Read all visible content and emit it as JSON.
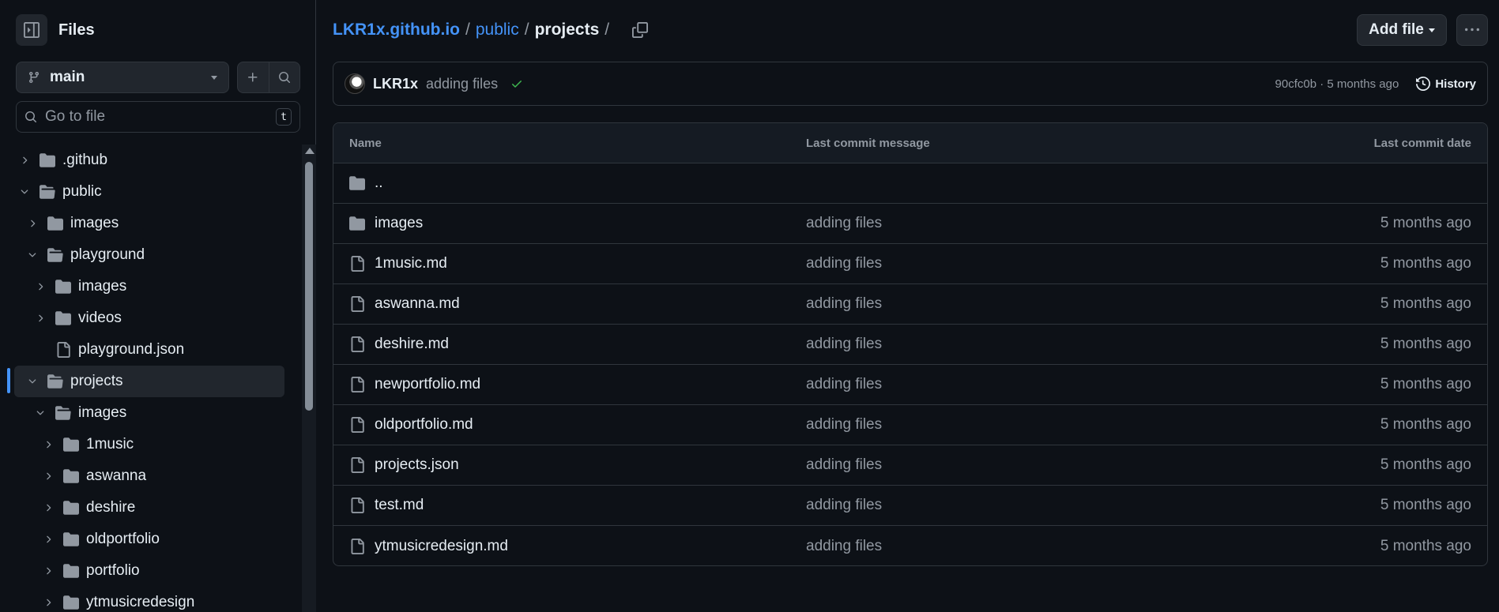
{
  "sidebar": {
    "title": "Files",
    "branch": "main",
    "goto_placeholder": "Go to file",
    "goto_shortcut": "t",
    "tree": [
      {
        "label": ".github",
        "depth": 0,
        "type": "folder",
        "expanded": false
      },
      {
        "label": "public",
        "depth": 0,
        "type": "folder",
        "expanded": true
      },
      {
        "label": "images",
        "depth": 1,
        "type": "folder",
        "expanded": false
      },
      {
        "label": "playground",
        "depth": 1,
        "type": "folder",
        "expanded": true
      },
      {
        "label": "images",
        "depth": 2,
        "type": "folder",
        "expanded": false
      },
      {
        "label": "videos",
        "depth": 2,
        "type": "folder",
        "expanded": false
      },
      {
        "label": "playground.json",
        "depth": 2,
        "type": "file"
      },
      {
        "label": "projects",
        "depth": 1,
        "type": "folder",
        "expanded": true,
        "active": true
      },
      {
        "label": "images",
        "depth": 2,
        "type": "folder",
        "expanded": true
      },
      {
        "label": "1music",
        "depth": 3,
        "type": "folder",
        "expanded": false
      },
      {
        "label": "aswanna",
        "depth": 3,
        "type": "folder",
        "expanded": false
      },
      {
        "label": "deshire",
        "depth": 3,
        "type": "folder",
        "expanded": false
      },
      {
        "label": "oldportfolio",
        "depth": 3,
        "type": "folder",
        "expanded": false
      },
      {
        "label": "portfolio",
        "depth": 3,
        "type": "folder",
        "expanded": false
      },
      {
        "label": "ytmusicredesign",
        "depth": 3,
        "type": "folder",
        "expanded": false
      }
    ]
  },
  "breadcrumb": {
    "repo": "LKR1x.github.io",
    "sep": "/",
    "parent": "public",
    "current": "projects"
  },
  "toolbar": {
    "add_file_label": "Add file"
  },
  "commit": {
    "author": "LKR1x",
    "message": "adding files",
    "meta": "90cfc0b · 5 months ago",
    "history_label": "History"
  },
  "table": {
    "headers": {
      "name": "Name",
      "message": "Last commit message",
      "date": "Last commit date"
    },
    "rows": [
      {
        "name": "..",
        "type": "parent",
        "message": "",
        "date": ""
      },
      {
        "name": "images",
        "type": "folder",
        "message": "adding files",
        "date": "5 months ago"
      },
      {
        "name": "1music.md",
        "type": "file",
        "message": "adding files",
        "date": "5 months ago"
      },
      {
        "name": "aswanna.md",
        "type": "file",
        "message": "adding files",
        "date": "5 months ago"
      },
      {
        "name": "deshire.md",
        "type": "file",
        "message": "adding files",
        "date": "5 months ago"
      },
      {
        "name": "newportfolio.md",
        "type": "file",
        "message": "adding files",
        "date": "5 months ago"
      },
      {
        "name": "oldportfolio.md",
        "type": "file",
        "message": "adding files",
        "date": "5 months ago"
      },
      {
        "name": "projects.json",
        "type": "file",
        "message": "adding files",
        "date": "5 months ago"
      },
      {
        "name": "test.md",
        "type": "file",
        "message": "adding files",
        "date": "5 months ago"
      },
      {
        "name": "ytmusicredesign.md",
        "type": "file",
        "message": "adding files",
        "date": "5 months ago"
      }
    ]
  },
  "colors": {
    "accent": "#4493f8",
    "success": "#3fb950",
    "background": "#0d1117",
    "border": "#30363d"
  }
}
